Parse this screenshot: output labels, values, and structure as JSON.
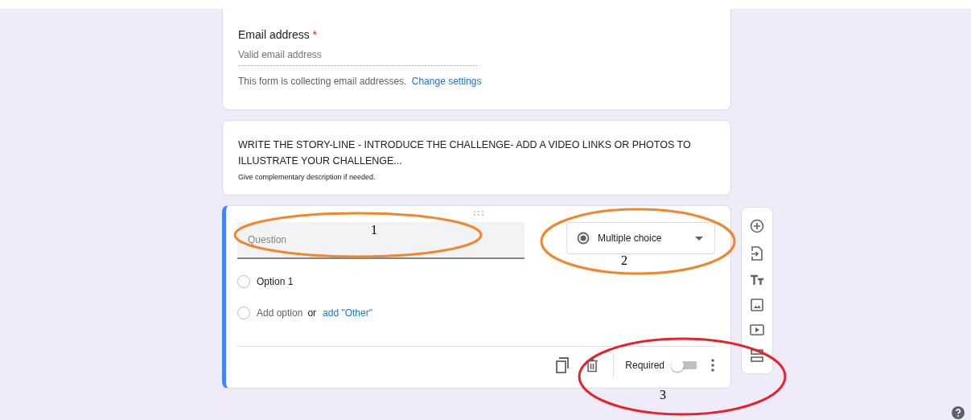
{
  "email_card": {
    "label": "Email address",
    "required_mark": "*",
    "placeholder": "Valid email address",
    "note": "This form is collecting email addresses.",
    "link": "Change settings"
  },
  "description_card": {
    "title": "WRITE THE STORY-LINE - INTRODUCE THE CHALLENGE- ADD A VIDEO LINKS OR PHOTOS TO ILLUSTRATE YOUR CHALLENGE...",
    "description": "Give complementary description if needed."
  },
  "question_card": {
    "placeholder": "Question",
    "type": "Multiple choice",
    "options": [
      {
        "label": "Option 1",
        "selected": false
      }
    ],
    "add_option_selected": false,
    "add_option": "Add option",
    "or": "or",
    "add_other": "add \"Other\"",
    "required_label": "Required",
    "required": false
  },
  "annotations": [
    {
      "label": "1",
      "color": "#f5852a"
    },
    {
      "label": "2",
      "color": "#f5852a"
    },
    {
      "label": "3",
      "color": "#e8212a"
    }
  ]
}
